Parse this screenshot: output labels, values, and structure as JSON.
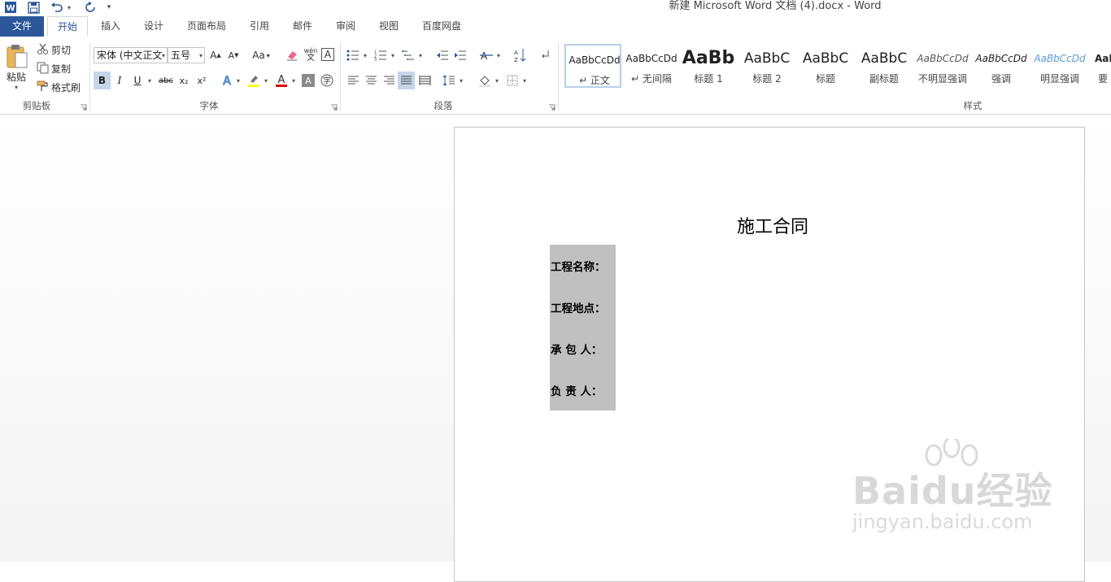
{
  "app": {
    "title": "新建 Microsoft Word 文档 (4).docx - Word"
  },
  "qat": {
    "word_icon": "word-logo-icon",
    "save_icon": "save-icon",
    "undo_icon": "undo-icon",
    "redo_icon": "redo-icon",
    "customize_icon": "customize-qat-icon"
  },
  "tabs": [
    {
      "label": "文件"
    },
    {
      "label": "开始"
    },
    {
      "label": "插入"
    },
    {
      "label": "设计"
    },
    {
      "label": "页面布局"
    },
    {
      "label": "引用"
    },
    {
      "label": "邮件"
    },
    {
      "label": "审阅"
    },
    {
      "label": "视图"
    },
    {
      "label": "百度网盘"
    }
  ],
  "ribbon": {
    "clipboard": {
      "paste": "粘贴",
      "cut": "剪切",
      "copy": "复制",
      "format_painter": "格式刷",
      "group_label": "剪贴板"
    },
    "font": {
      "font_name": "宋体 (中文正文",
      "font_size": "五号",
      "change_case": "Aa",
      "bold": "B",
      "italic": "I",
      "underline": "U",
      "strikethrough": "abc",
      "subscript": "x₂",
      "superscript": "x²",
      "group_label": "字体"
    },
    "paragraph": {
      "group_label": "段落"
    },
    "styles": {
      "items": [
        {
          "sample": "AaBbCcDd",
          "name": "↵ 正文"
        },
        {
          "sample": "AaBbCcDd",
          "name": "↵ 无间隔"
        },
        {
          "sample": "AaBb",
          "name": "标题 1"
        },
        {
          "sample": "AaBbC",
          "name": "标题 2"
        },
        {
          "sample": "AaBbC",
          "name": "标题"
        },
        {
          "sample": "AaBbC",
          "name": "副标题"
        },
        {
          "sample": "AaBbCcDd",
          "name": "不明显强调"
        },
        {
          "sample": "AaBbCcDd",
          "name": "强调"
        },
        {
          "sample": "AaBbCcDd",
          "name": "明显强调"
        },
        {
          "sample": "AaBl",
          "name": "要"
        }
      ],
      "group_label": "样式"
    }
  },
  "document": {
    "title": "施工合同",
    "fields": [
      {
        "label": "工程名称："
      },
      {
        "label": "工程地点："
      },
      {
        "label": "承 包 人："
      },
      {
        "label": "负 责 人："
      }
    ]
  },
  "watermark": {
    "brand": "Baidu经验",
    "url": "jingyan.baidu.com"
  },
  "colors": {
    "accent": "#2b579a",
    "field_highlight": "#c0c0c0"
  }
}
